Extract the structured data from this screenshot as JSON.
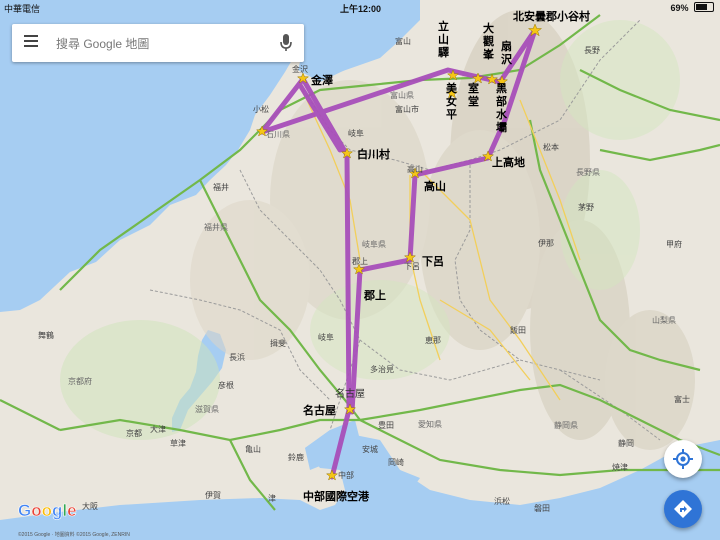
{
  "status_bar": {
    "carrier": "中華電信",
    "time": "上午12:00",
    "battery": "69%",
    "battery_level": 0.69
  },
  "search": {
    "placeholder": "搜尋 Google 地圖"
  },
  "icons": {
    "menu": "menu-icon",
    "mic": "mic-icon",
    "my_location": "my-location-icon",
    "directions": "directions-icon"
  },
  "colors": {
    "route": "#a84fba",
    "star": "#f5c518",
    "sea": "#a6cdf2",
    "highway": "#72b84a",
    "fab_blue": "#2f74d6"
  },
  "route_labels": {
    "kitaazumi": "北安曇郡小谷村",
    "tateyama": "立山驛",
    "daikanbo": "大觀峯",
    "bodaira": "扇沢",
    "bijodaira": "美女平",
    "murodo": "室堂",
    "kurobe": "黑部水壩",
    "kanazawa": "金澤",
    "shirakawa": "白川村",
    "kamikochi": "上高地",
    "takayama": "高山",
    "gero": "下呂",
    "gujo": "郡上",
    "nagoya": "名古屋",
    "chubu": "中部國際空港"
  },
  "map_labels": {
    "toyama": "富山",
    "toyama_ken": "富山県",
    "toyama_city": "富山市",
    "nagano": "長野",
    "nagano_ken": "長野県",
    "matsumoto": "松本",
    "chino": "茅野",
    "ina": "伊那",
    "iida": "飯田",
    "yamanashi": "山梨県",
    "kofu": "甲府",
    "fuji": "富士",
    "shizuoka": "静岡",
    "shizuoka_ken": "静岡県",
    "yaizu": "焼津",
    "hamamatsu": "浜松",
    "iwata": "磐田",
    "toyota": "豊田",
    "okazaki": "岡崎",
    "anjo": "安城",
    "aichi": "愛知県",
    "gifu": "岐阜",
    "gifu_ken": "岐阜県",
    "gujo_map": "郡上",
    "gero_map": "下呂",
    "takayama_map": "高山",
    "ena": "恵那",
    "tajimi": "多治見",
    "kyoto_fu": "京都府",
    "kyoto": "京都",
    "shiga": "滋賀県",
    "tsu": "津",
    "suzuka": "鈴鹿",
    "osaka": "大阪",
    "fukui": "福井",
    "fukui_ken": "福井県",
    "maizuru": "舞鶴",
    "komatsu": "小松",
    "ishikawa": "石川県",
    "kanazawa_map": "金沢",
    "nagoya_map": "名古屋",
    "chubu_map": "中部",
    "ibi": "揖斐",
    "gifu_small": "岐阜",
    "nagahama": "長浜",
    "hikone": "彦根",
    "kusatsu": "草津",
    "otsu": "大津",
    "kameyama": "亀山",
    "iga": "伊賀"
  },
  "google_logo": "Google",
  "copyright": "©2015 Google · 地圖資料 ©2015 Google, ZENRIN"
}
